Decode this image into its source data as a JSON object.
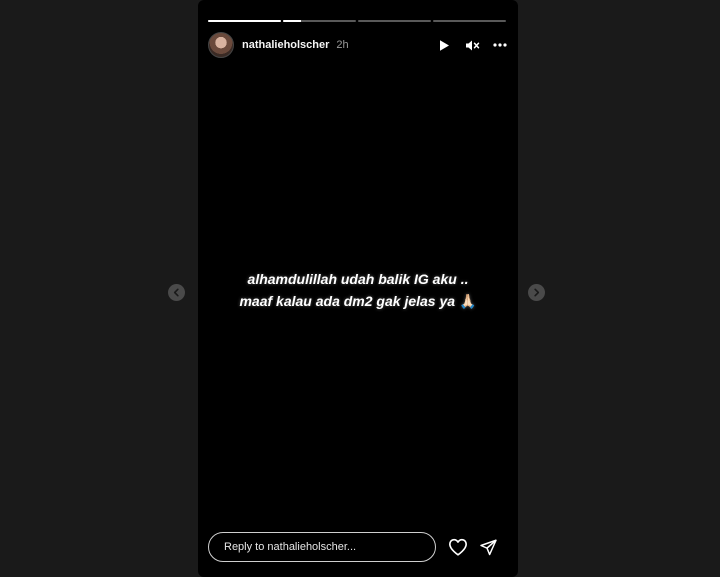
{
  "story": {
    "progress": [
      1.0,
      0.25,
      0.0,
      0.0
    ],
    "header": {
      "username": "nathalieholscher",
      "timestamp": "2h",
      "controls": [
        "play-icon",
        "mute-icon",
        "more-options-icon"
      ]
    },
    "caption": {
      "line1": "alhamdulillah udah balik IG aku ..",
      "line2": "maaf kalau ada dm2 gak jelas ya",
      "emoji": "🙏🏻"
    },
    "reply": {
      "placeholder": "Reply to nathalieholscher..."
    },
    "footer_icons": [
      "heart-icon",
      "send-icon"
    ]
  },
  "navigation": {
    "prev": "chevron-left-icon",
    "next": "chevron-right-icon"
  },
  "colors": {
    "viewer_background": "#1a1a1a",
    "story_background": "#000000",
    "text": "#ffffff",
    "timestamp": "#9a9a9a"
  }
}
